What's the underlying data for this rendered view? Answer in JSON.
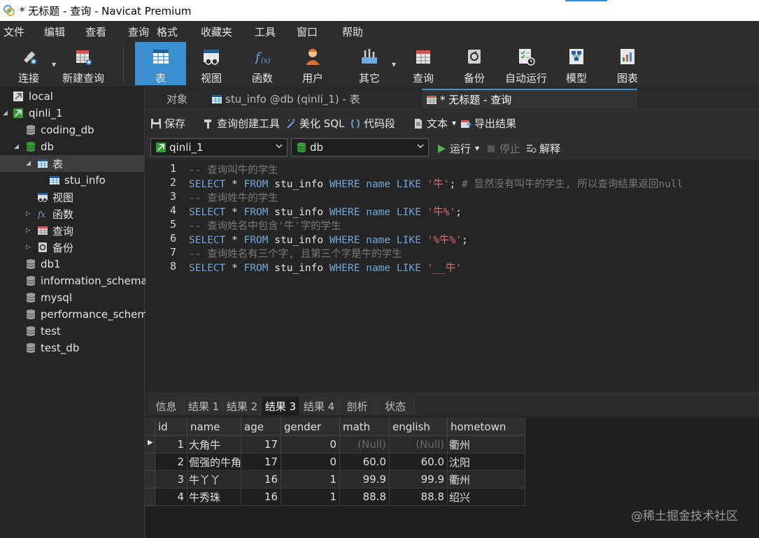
{
  "window": {
    "title": "* 无标题 - 查询 - Navicat Premium"
  },
  "menu": [
    "文件",
    "编辑",
    "查看",
    "查询",
    "格式",
    "收藏夹",
    "工具",
    "窗口",
    "帮助"
  ],
  "toolbar": {
    "buttons": [
      {
        "label": "连接",
        "icon": "plug-icon"
      },
      {
        "label": "新建查询",
        "icon": "new-query-icon"
      },
      {
        "label": "表",
        "icon": "table-icon"
      },
      {
        "label": "视图",
        "icon": "view-icon"
      },
      {
        "label": "函数",
        "icon": "function-icon"
      },
      {
        "label": "用户",
        "icon": "user-icon"
      },
      {
        "label": "其它",
        "icon": "tools-icon"
      },
      {
        "label": "查询",
        "icon": "query-icon"
      },
      {
        "label": "备份",
        "icon": "backup-icon"
      },
      {
        "label": "自动运行",
        "icon": "schedule-icon"
      },
      {
        "label": "模型",
        "icon": "model-icon"
      },
      {
        "label": "图表",
        "icon": "chart-icon"
      }
    ]
  },
  "sidebar": {
    "tree": [
      {
        "label": "local"
      },
      {
        "label": "qinli_1"
      },
      {
        "label": "coding_db"
      },
      {
        "label": "db"
      },
      {
        "label": "表"
      },
      {
        "label": "stu_info"
      },
      {
        "label": "视图"
      },
      {
        "label": "函数"
      },
      {
        "label": "查询"
      },
      {
        "label": "备份"
      },
      {
        "label": "db1"
      },
      {
        "label": "information_schema"
      },
      {
        "label": "mysql"
      },
      {
        "label": "performance_schem"
      },
      {
        "label": "test"
      },
      {
        "label": "test_db"
      }
    ]
  },
  "tabs": [
    {
      "label": "对象"
    },
    {
      "label": "stu_info @db (qinli_1) - 表"
    },
    {
      "label": "* 无标题 - 查询"
    }
  ],
  "query_toolbar": {
    "save": "保存",
    "builder": "查询创建工具",
    "beautify": "美化 SQL",
    "snippet": "代码段",
    "text": "文本",
    "export": "导出结果"
  },
  "selectors": {
    "connection": "qinli_1",
    "database": "db",
    "run": "运行",
    "stop": "停止",
    "explain": "解释"
  },
  "editor": {
    "line_numbers": [
      "1",
      "2",
      "3",
      "4",
      "5",
      "6",
      "7",
      "8"
    ]
  },
  "result_tabs": [
    "信息",
    "结果 1",
    "结果 2",
    "结果 3",
    "结果 4",
    "剖析",
    "状态"
  ],
  "grid": {
    "columns": [
      "id",
      "name",
      "age",
      "gender",
      "math",
      "english",
      "hometown"
    ],
    "rows": [
      [
        "1",
        "大角牛",
        "17",
        "0",
        "(Null)",
        "(Null)",
        "衢州"
      ],
      [
        "2",
        "倔强的牛角",
        "17",
        "0",
        "60.0",
        "60.0",
        "沈阳"
      ],
      [
        "3",
        "牛丫丫",
        "16",
        "1",
        "99.9",
        "99.9",
        "衢州"
      ],
      [
        "4",
        "牛秀珠",
        "16",
        "1",
        "88.8",
        "88.8",
        "绍兴"
      ]
    ]
  },
  "watermark": "@稀土掘金技术社区"
}
